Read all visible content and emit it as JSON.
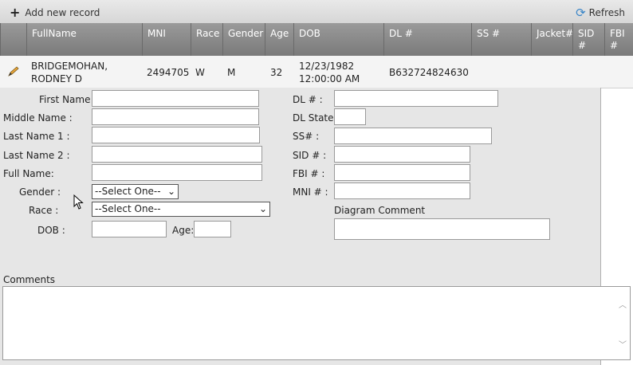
{
  "toolbar": {
    "add_label": "Add new record",
    "refresh_label": "Refresh"
  },
  "columns": [
    "FullName",
    "MNI",
    "Race",
    "Gender",
    "Age",
    "DOB",
    "DL #",
    "SS #",
    "Jacket#",
    "SID #",
    "FBI #"
  ],
  "row": {
    "fullname_line1": "BRIDGEMOHAN,",
    "fullname_line2": "RODNEY D",
    "mni": "2494705",
    "race": "W",
    "gender": "M",
    "age": "32",
    "dob_line1": "12/23/1982",
    "dob_line2": "12:00:00 AM",
    "dl": "B632724824630"
  },
  "form": {
    "first_name": "First Name :",
    "middle_name": "Middle Name :",
    "last_name_1": "Last Name 1 :",
    "last_name_2": "Last Name 2 :",
    "full_name": "Full Name:",
    "gender": "Gender :",
    "race": "Race :",
    "dob": "DOB :",
    "age": "Age:",
    "dl": "DL # :",
    "dl_state": "DL State :",
    "ss": "SS# :",
    "sid": "SID # :",
    "fbi": "FBI # :",
    "mni": "MNI # :",
    "diagram_comment": "Diagram Comment",
    "comments": "Comments",
    "gender_select": "--Select One--",
    "race_select": "--Select One--"
  }
}
